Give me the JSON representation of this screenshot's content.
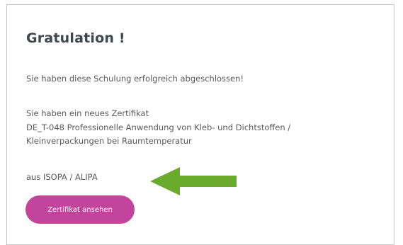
{
  "dialog": {
    "title": "Gratulation !",
    "message": "Sie haben diese Schulung erfolgreich abgeschlossen!",
    "certificate_intro": "Sie haben ein neues Zertifikat",
    "certificate_name_line1": "DE_T-048 Professionelle Anwendung von Kleb- und Dichtstoffen /",
    "certificate_name_line2": "Kleinverpackungen bei Raumtemperatur",
    "issuer": "aus ISOPA / ALIPA",
    "view_button_label": "Zertifikat ansehen"
  },
  "annotation": {
    "arrow_icon": "left-arrow-icon",
    "arrow_color": "#6aab2d"
  },
  "colors": {
    "button": "#c3449b",
    "title": "#3d4750",
    "text": "#5a5a5a"
  }
}
